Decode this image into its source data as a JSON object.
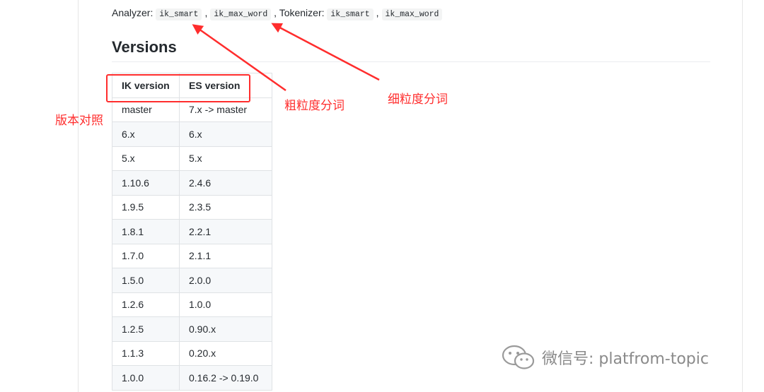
{
  "analyzer": {
    "label": "Analyzer:",
    "code1": "ik_smart",
    "sep1": ",",
    "code2": "ik_max_word",
    "sep2": ", Tokenizer:",
    "code3": "ik_smart",
    "sep3": ",",
    "code4": "ik_max_word"
  },
  "section": {
    "title": "Versions"
  },
  "table": {
    "headers": [
      "IK version",
      "ES version"
    ],
    "rows": [
      [
        "master",
        "7.x -> master"
      ],
      [
        "6.x",
        "6.x"
      ],
      [
        "5.x",
        "5.x"
      ],
      [
        "1.10.6",
        "2.4.6"
      ],
      [
        "1.9.5",
        "2.3.5"
      ],
      [
        "1.8.1",
        "2.2.1"
      ],
      [
        "1.7.0",
        "2.1.1"
      ],
      [
        "1.5.0",
        "2.0.0"
      ],
      [
        "1.2.6",
        "1.0.0"
      ],
      [
        "1.2.5",
        "0.90.x"
      ],
      [
        "1.1.3",
        "0.20.x"
      ],
      [
        "1.0.0",
        "0.16.2 -> 0.19.0"
      ]
    ]
  },
  "annotations": {
    "version_compare": "版本对照",
    "coarse": "粗粒度分词",
    "fine": "细粒度分词",
    "color": "#ff2d2d"
  },
  "watermark": {
    "icon": "wechat-icon",
    "text": "微信号: platfrom-topic"
  }
}
